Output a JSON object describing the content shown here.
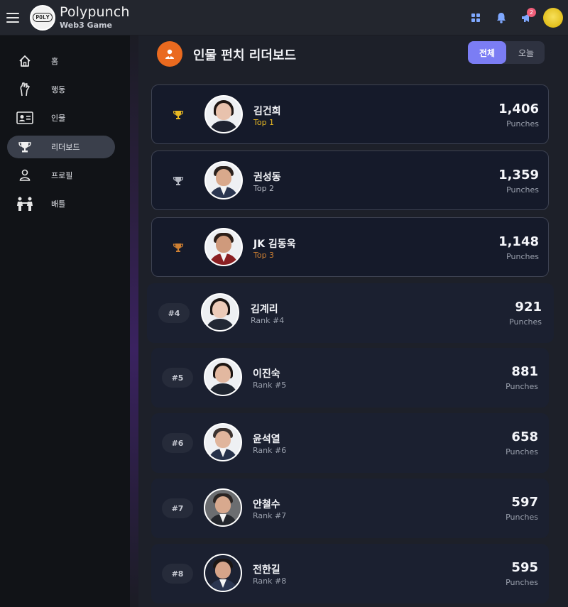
{
  "app": {
    "name": "Polypunch",
    "subtitle": "Web3 Game",
    "logo_text": "POLY"
  },
  "header": {
    "icons": [
      "grid-icon",
      "bell-icon",
      "megaphone-icon"
    ],
    "notification_count": "2"
  },
  "sidebar": {
    "items": [
      {
        "label": "홈",
        "icon": "home-icon",
        "active": false
      },
      {
        "label": "행동",
        "icon": "hand-icon",
        "active": false
      },
      {
        "label": "인물",
        "icon": "id-card-icon",
        "active": false
      },
      {
        "label": "리더보드",
        "icon": "trophy-icon",
        "active": true
      },
      {
        "label": "프로필",
        "icon": "person-icon",
        "active": false
      },
      {
        "label": "배틀",
        "icon": "battle-icon",
        "active": false
      }
    ]
  },
  "leaderboard": {
    "title": "인물 펀치 리더보드",
    "tabs": {
      "all": "전체",
      "today": "오늘"
    },
    "selected_tab": "전체",
    "unit": "Punches",
    "entries": [
      {
        "rank": 1,
        "name": "김건희",
        "sub": "Top 1",
        "value": "1,406",
        "tier": "gold"
      },
      {
        "rank": 2,
        "name": "권성동",
        "sub": "Top 2",
        "value": "1,359",
        "tier": "silver"
      },
      {
        "rank": 3,
        "name": "JK 김동욱",
        "sub": "Top 3",
        "value": "1,148",
        "tier": "bronze"
      },
      {
        "rank": 4,
        "badge": "#4",
        "name": "김계리",
        "sub": "Rank #4",
        "value": "921"
      },
      {
        "rank": 5,
        "badge": "#5",
        "name": "이진숙",
        "sub": "Rank #5",
        "value": "881"
      },
      {
        "rank": 6,
        "badge": "#6",
        "name": "윤석열",
        "sub": "Rank #6",
        "value": "658"
      },
      {
        "rank": 7,
        "badge": "#7",
        "name": "안철수",
        "sub": "Rank #7",
        "value": "597"
      },
      {
        "rank": 8,
        "badge": "#8",
        "name": "전한길",
        "sub": "Rank #8",
        "value": "595"
      }
    ]
  },
  "colors": {
    "accent": "#7b7df4",
    "gold": "#e8b923",
    "silver": "#b4b8c2",
    "bronze": "#cd7f32",
    "header_icon_bg": "#ea6a1f"
  }
}
